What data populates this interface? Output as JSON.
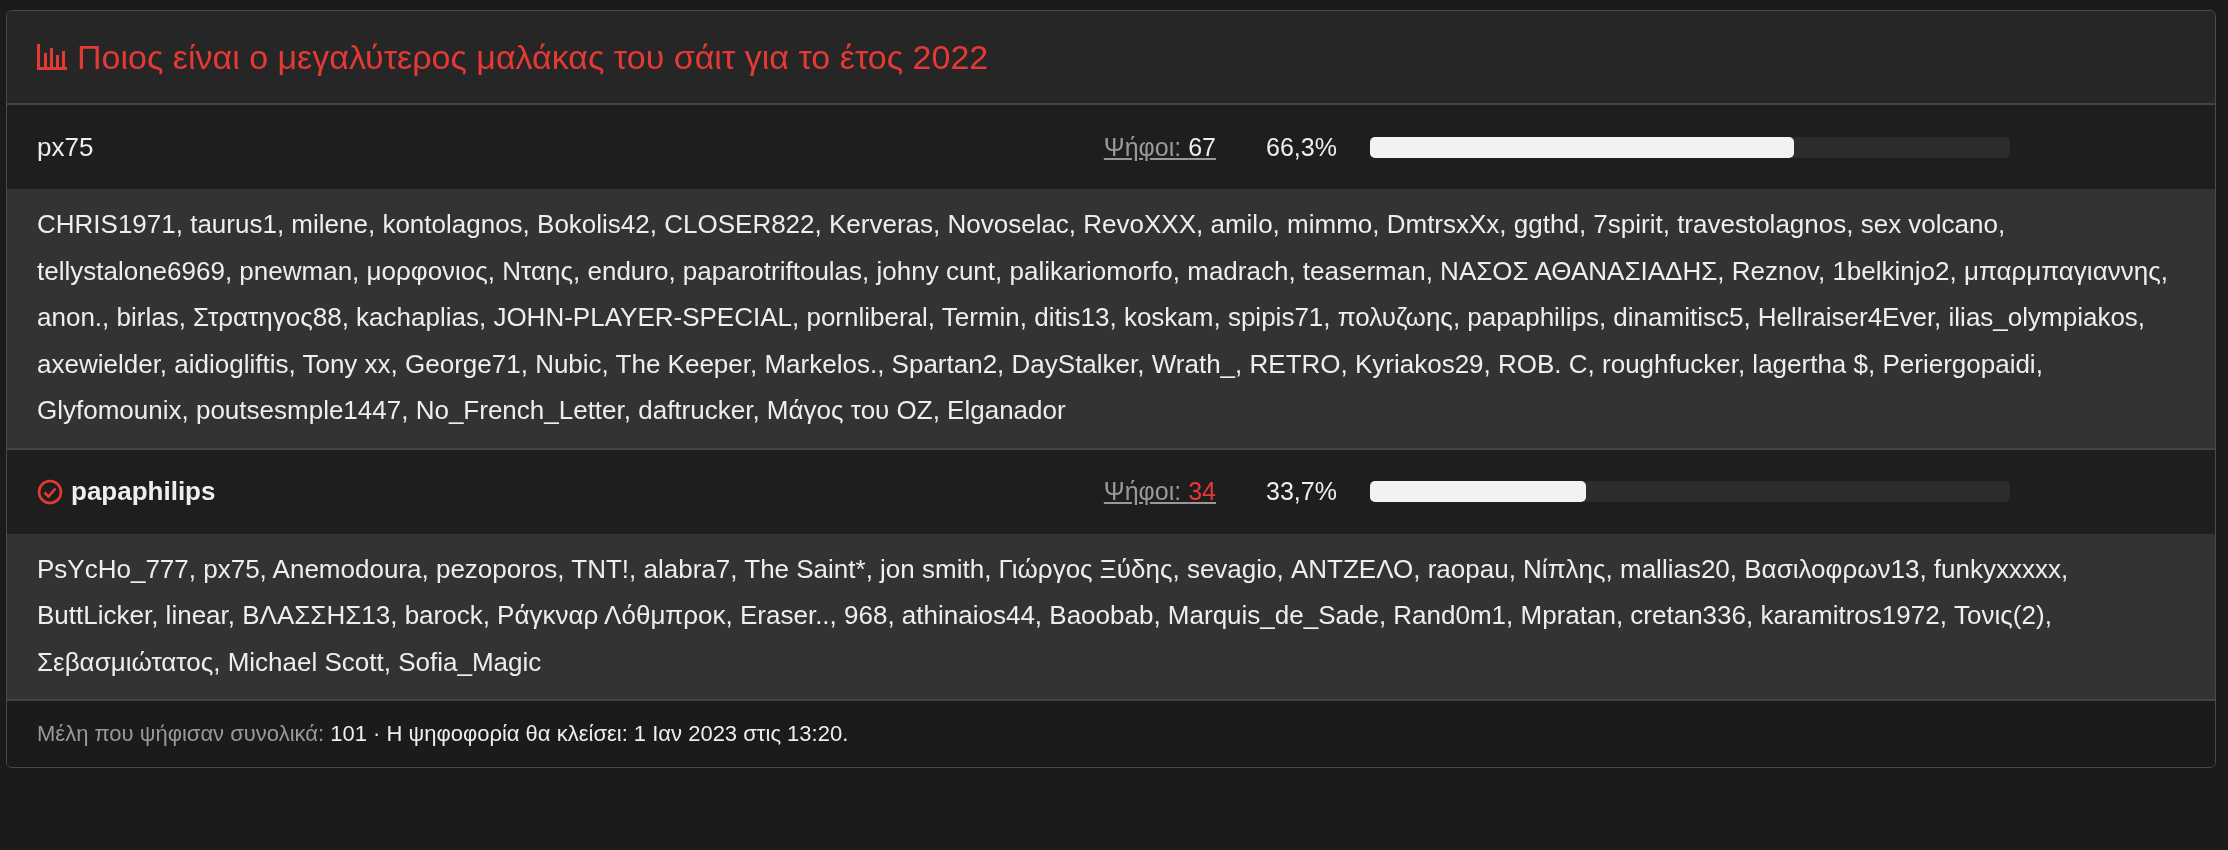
{
  "poll": {
    "title": "Ποιος είναι ο μεγαλύτερος μαλάκας του σάιτ για το έτος 2022",
    "options": [
      {
        "name": "px75",
        "selected": false,
        "votes_label": "Ψήφοι:",
        "votes": "67",
        "percent": "66,3%",
        "level": 0.663,
        "voters": "CHRIS1971, taurus1, milene, kontolagnos, Bokolis42, CLOSER822, Kerveras, Novoselac, RevoXXX, amilo, mimmo, DmtrsxXx, ggthd, 7spirit, travestolagnos, sex volcano, tellystalone6969, pnewman, μορφονιος, Νταης, enduro, paparotriftoulas, johny cunt, palikariomorfo, madrach, teaserman, ΝΑΣΟΣ ΑΘΑΝΑΣΙΑΔΗΣ, Reznov, 1belkinjo2, μπαρμπαγιαννης, anon., birlas, Στρατηγος88, kachaplias, JOHN-PLAYER-SPECIAL, pornliberal, Termin, ditis13, koskam, spipis71, πολυζωης, papaphilips, dinamitisc5, Hellraiser4Ever, ilias_olympiakos, axewielder, aidiogliftis, Tony xx, George71, Nubic, The Keeper, Markelos., Spartan2, DayStalker, Wrath_, RETRO, Kyriakos29, ROB. C, roughfucker, lagertha $, Periergopaidi, Glyfomounix, poutsesmple1447, No_French_Letter, daftrucker, Μάγος του OZ, Elganador"
      },
      {
        "name": "papaphilips",
        "selected": true,
        "votes_label": "Ψήφοι:",
        "votes": "34",
        "percent": "33,7%",
        "level": 0.337,
        "voters": "PsYcHo_777, px75, Anemodoura, pezoporos, TNT!, alabra7, The Saint*, jon smith, Γιώργος Ξύδης, sevagio, ΑΝΤΖΕΛΟ, raopau, Νίπλης, mallias20, Βασιλοφρων13, funkyxxxxx, ButtLicker, linear, ΒΛΑΣΣΗΣ13, barock, Ράγκναρ Λόθμπροκ, Eraser.., 968, athinaios44, Baoobab, Marquis_de_Sade, Rand0m1, Mpratan, cretan336, karamitros1972, Τονις(2), Σεβασμιώτατος, Michael Scott, Sofia_Magic"
      }
    ],
    "footer": {
      "members_label": "Μέλη που ψήφισαν συνολικά:",
      "members": "101",
      "separator": "·",
      "closing_label": "Η ψηφοφορία θα κλείσει:",
      "closing": "1 Ιαν 2023 στις 13:20."
    }
  }
}
